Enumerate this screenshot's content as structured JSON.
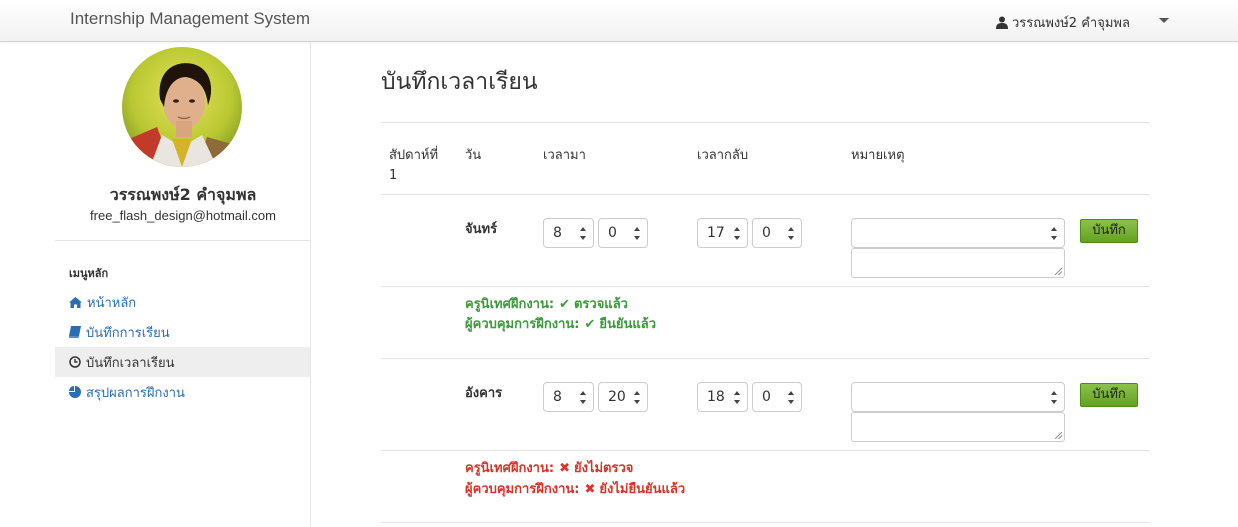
{
  "navbar": {
    "brand": "Internship Management System",
    "user_name": "วรรณพงษ์2 คำจุมพล",
    "user_icon": "user-icon",
    "dropdown_icon": "caret-down-icon"
  },
  "profile": {
    "name": "วรรณพงษ์2 คำจุมพล",
    "email": "free_flash_design@hotmail.com"
  },
  "sidebar": {
    "header": "เมนูหลัก",
    "items": [
      {
        "label": "หน้าหลัก",
        "icon": "home-icon"
      },
      {
        "label": "บันทึกการเรียน",
        "icon": "book-icon"
      },
      {
        "label": "บันทึกเวลาเรียน",
        "icon": "clock-icon",
        "active": true
      },
      {
        "label": "สรุปผลการฝึกงาน",
        "icon": "pie-chart-icon"
      }
    ]
  },
  "main": {
    "title": "บันทึกเวลาเรียน",
    "table": {
      "headers": {
        "week": "สัปดาห์ที่ 1",
        "day": "วัน",
        "time_in": "เวลามา",
        "time_out": "เวลากลับ",
        "note": "หมายเหตุ"
      },
      "rows": [
        {
          "day": "จันทร์",
          "in_hour": "8",
          "in_min": "0",
          "out_hour": "17",
          "out_min": "0",
          "note_select": "",
          "save_label": "บันทึก",
          "teacher_label": "ครูนิเทศฝึกงาน:",
          "teacher_status": "ตรวจแล้ว",
          "teacher_icon": "check-icon",
          "supervisor_label": "ผู้ควบคุมการฝึกงาน:",
          "supervisor_status": "ยืนยันแล้ว",
          "supervisor_icon": "check-icon",
          "status_color": "#3c9a3c"
        },
        {
          "day": "อังคาร",
          "in_hour": "8",
          "in_min": "20",
          "out_hour": "18",
          "out_min": "0",
          "note_select": "",
          "save_label": "บันทึก",
          "teacher_label": "ครูนิเทศฝึกงาน:",
          "teacher_status": "ยังไม่ตรวจ",
          "teacher_icon": "x-icon",
          "supervisor_label": "ผู้ควบคุมการฝึกงาน:",
          "supervisor_status": "ยังไม่ยืนยันแล้ว",
          "supervisor_icon": "x-icon",
          "status_color": "#d9332a"
        }
      ]
    }
  },
  "colors": {
    "link": "#2a6eb5",
    "save_button": "#7ab539",
    "ok": "#3c9a3c",
    "bad": "#d9332a"
  }
}
